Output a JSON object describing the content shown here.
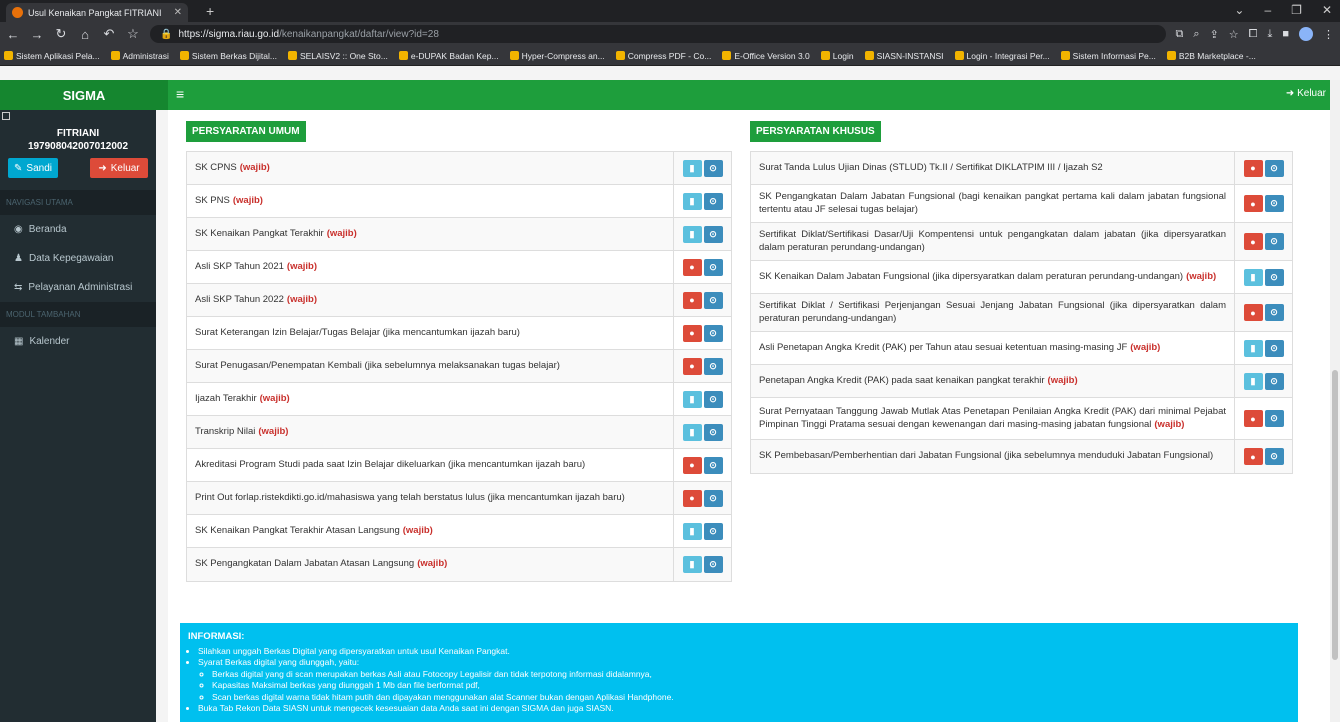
{
  "browser": {
    "tab_title": "Usul Kenaikan Pangkat FITRIANI",
    "url_domain": "https://sigma.riau.go.id",
    "url_path": "/kenaikanpangkat/daftar/view?id=28",
    "bookmarks": [
      "Sistem Aplikasi Pela...",
      "Administrasi",
      "Sistem Berkas Dijital...",
      "SELAISV2 :: One Sto...",
      "e-DUPAK Badan Kep...",
      "Hyper-Compress an...",
      "Compress PDF - Co...",
      "E-Office Version 3.0",
      "Login",
      "SIASN-INSTANSI",
      "Login - Integrasi Per...",
      "Sistem Informasi Pe...",
      "B2B Marketplace -..."
    ]
  },
  "header": {
    "brand": "SIGMA",
    "logout": "Keluar"
  },
  "sidebar": {
    "user_name": "FITRIANI",
    "user_nip": "197908042007012002",
    "sandi_label": "Sandi",
    "keluar_label": "Keluar",
    "section1": "NAVIGASI UTAMA",
    "items": [
      {
        "label": "Beranda"
      },
      {
        "label": "Data Kepegawaian"
      },
      {
        "label": "Pelayanan Administrasi"
      }
    ],
    "section2": "MODUL TAMBAHAN",
    "items2": [
      {
        "label": "Kalender"
      }
    ]
  },
  "umum": {
    "title": "PERSYARATAN UMUM",
    "rows": [
      {
        "text": "SK CPNS",
        "wajib": "(wajib)",
        "status": "uploaded"
      },
      {
        "text": "SK PNS",
        "wajib": "(wajib)",
        "status": "uploaded"
      },
      {
        "text": "SK Kenaikan Pangkat Terakhir",
        "wajib": "(wajib)",
        "status": "uploaded"
      },
      {
        "text": "Asli SKP Tahun 2021",
        "wajib": "(wajib)",
        "status": "missing"
      },
      {
        "text": "Asli SKP Tahun 2022",
        "wajib": "(wajib)",
        "status": "missing"
      },
      {
        "text": "Surat Keterangan Izin Belajar/Tugas Belajar (jika mencantumkan ijazah baru)",
        "wajib": "",
        "status": "missing"
      },
      {
        "text": "Surat Penugasan/Penempatan Kembali (jika sebelumnya melaksanakan tugas belajar)",
        "wajib": "",
        "status": "missing"
      },
      {
        "text": "Ijazah Terakhir",
        "wajib": "(wajib)",
        "status": "uploaded"
      },
      {
        "text": "Transkrip Nilai",
        "wajib": "(wajib)",
        "status": "uploaded"
      },
      {
        "text": "Akreditasi Program Studi pada saat Izin Belajar dikeluarkan (jika mencantumkan ijazah baru)",
        "wajib": "",
        "status": "missing"
      },
      {
        "text": "Print Out forlap.ristekdikti.go.id/mahasiswa yang telah berstatus lulus (jika mencantumkan ijazah baru)",
        "wajib": "",
        "status": "missing"
      },
      {
        "text": "SK Kenaikan Pangkat Terakhir Atasan Langsung",
        "wajib": "(wajib)",
        "status": "uploaded"
      },
      {
        "text": "SK Pengangkatan Dalam Jabatan Atasan Langsung",
        "wajib": "(wajib)",
        "status": "uploaded"
      }
    ]
  },
  "khusus": {
    "title": "PERSYARATAN KHUSUS",
    "rows": [
      {
        "text": "Surat Tanda Lulus Ujian Dinas (STLUD) Tk.II / Sertifikat DIKLATPIM III / Ijazah S2",
        "wajib": "",
        "status": "missing"
      },
      {
        "text": "SK Pengangkatan Dalam Jabatan Fungsional (bagi kenaikan pangkat pertama kali dalam jabatan fungsional tertentu atau JF selesai tugas belajar)",
        "wajib": "",
        "status": "missing"
      },
      {
        "text": "Sertifikat Diklat/Sertifikasi Dasar/Uji Kompentensi untuk pengangkatan dalam jabatan (jika dipersyaratkan dalam peraturan perundang-undangan)",
        "wajib": "",
        "status": "missing"
      },
      {
        "text": "SK Kenaikan Dalam Jabatan Fungsional (jika dipersyaratkan dalam peraturan perundang-undangan)",
        "wajib": "(wajib)",
        "status": "uploaded"
      },
      {
        "text": "Sertifikat Diklat / Sertifikasi Perjenjangan Sesuai Jenjang Jabatan Fungsional (jika dipersyaratkan dalam peraturan perundang-undangan)",
        "wajib": "",
        "status": "missing"
      },
      {
        "text": "Asli Penetapan Angka Kredit (PAK) per Tahun atau sesuai ketentuan masing-masing JF",
        "wajib": "(wajib)",
        "status": "uploaded"
      },
      {
        "text": "Penetapan Angka Kredit (PAK) pada saat kenaikan pangkat terakhir",
        "wajib": "(wajib)",
        "status": "uploaded"
      },
      {
        "text": "Surat Pernyataan Tanggung Jawab Mutlak Atas Penetapan Penilaian Angka Kredit (PAK) dari minimal Pejabat Pimpinan Tinggi Pratama sesuai dengan kewenangan dari masing-masing jabatan fungsional",
        "wajib": "(wajib)",
        "status": "missing"
      },
      {
        "text": "SK Pembebasan/Pemberhentian dari Jabatan Fungsional (jika sebelumnya menduduki Jabatan Fungsional)",
        "wajib": "",
        "status": "missing"
      }
    ]
  },
  "info": {
    "title": "INFORMASI:",
    "items": [
      "Silahkan unggah Berkas Digital yang dipersyaratkan untuk usul Kenaikan Pangkat.",
      "Syarat Berkas digital yang diunggah, yaitu:"
    ],
    "subitems": [
      "Berkas digital yang di scan merupakan berkas Asli atau Fotocopy Legalisir dan tidak terpotong informasi didalamnya,",
      "Kapasitas Maksimal berkas yang diunggah 1 Mb dan file berformat pdf,",
      "Scan berkas digital warna tidak hitam putih dan dipayakan menggunakan alat Scanner bukan dengan Aplikasi Handphone."
    ],
    "last": "Buka Tab Rekon Data SIASN untuk mengecek kesesuaian data Anda saat ini dengan SIGMA dan juga SIASN."
  }
}
